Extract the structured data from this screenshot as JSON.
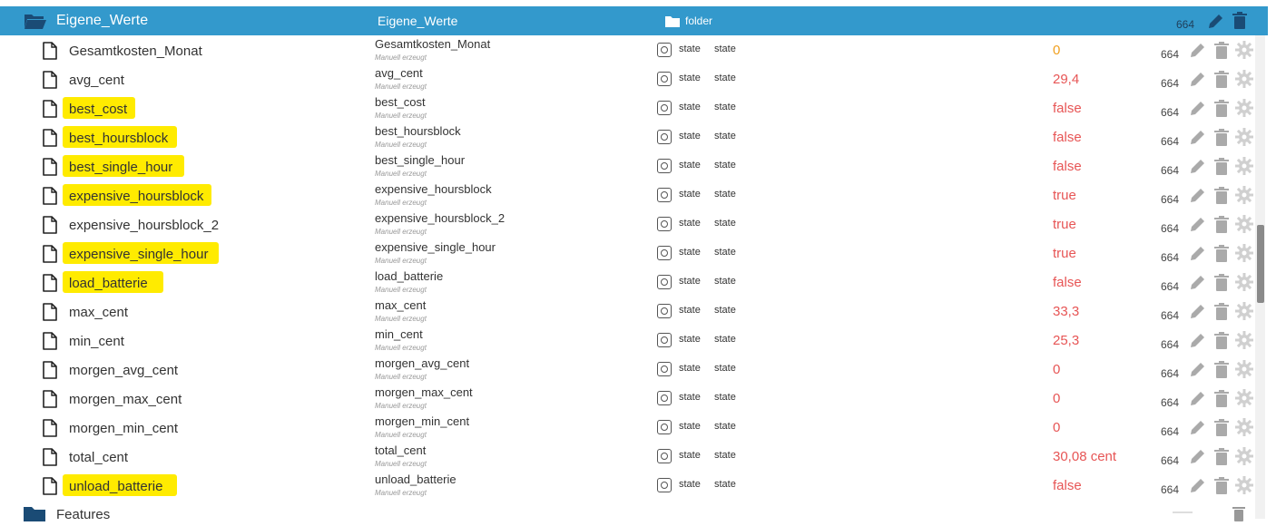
{
  "header": {
    "name": "Eigene_Werte",
    "name2": "Eigene_Werte",
    "type_label": "folder",
    "acl": "664",
    "icon": "folder-open-icon",
    "color": "#3399cc"
  },
  "rows": [
    {
      "name": "Gesamtkosten_Monat",
      "sub": "Manuell erzeugt",
      "role": "state",
      "type": "state",
      "value": "0",
      "value_color": "#f0a020",
      "acl": "664",
      "highlighted": false
    },
    {
      "name": "avg_cent",
      "sub": "Manuell erzeugt",
      "role": "state",
      "type": "state",
      "value": "29,4",
      "value_color": "#e75555",
      "acl": "664",
      "highlighted": false
    },
    {
      "name": "best_cost",
      "sub": "Manuell erzeugt",
      "role": "state",
      "type": "state",
      "value": "false",
      "value_color": "#e75555",
      "acl": "664",
      "highlighted": true
    },
    {
      "name": "best_hoursblock",
      "sub": "Manuell erzeugt",
      "role": "state",
      "type": "state",
      "value": "false",
      "value_color": "#e75555",
      "acl": "664",
      "highlighted": true
    },
    {
      "name": "best_single_hour",
      "sub": "Manuell erzeugt",
      "role": "state",
      "type": "state",
      "value": "false",
      "value_color": "#e75555",
      "acl": "664",
      "highlighted": true
    },
    {
      "name": "expensive_hoursblock",
      "sub": "Manuell erzeugt",
      "role": "state",
      "type": "state",
      "value": "true",
      "value_color": "#e75555",
      "acl": "664",
      "highlighted": true
    },
    {
      "name": "expensive_hoursblock_2",
      "sub": "Manuell erzeugt",
      "role": "state",
      "type": "state",
      "value": "true",
      "value_color": "#e75555",
      "acl": "664",
      "highlighted": false
    },
    {
      "name": "expensive_single_hour",
      "sub": "Manuell erzeugt",
      "role": "state",
      "type": "state",
      "value": "true",
      "value_color": "#e75555",
      "acl": "664",
      "highlighted": true
    },
    {
      "name": "load_batterie",
      "sub": "Manuell erzeugt",
      "role": "state",
      "type": "state",
      "value": "false",
      "value_color": "#e75555",
      "acl": "664",
      "highlighted": true
    },
    {
      "name": "max_cent",
      "sub": "Manuell erzeugt",
      "role": "state",
      "type": "state",
      "value": "33,3",
      "value_color": "#e75555",
      "acl": "664",
      "highlighted": false
    },
    {
      "name": "min_cent",
      "sub": "Manuell erzeugt",
      "role": "state",
      "type": "state",
      "value": "25,3",
      "value_color": "#e75555",
      "acl": "664",
      "highlighted": false
    },
    {
      "name": "morgen_avg_cent",
      "sub": "Manuell erzeugt",
      "role": "state",
      "type": "state",
      "value": "0",
      "value_color": "#e75555",
      "acl": "664",
      "highlighted": false
    },
    {
      "name": "morgen_max_cent",
      "sub": "Manuell erzeugt",
      "role": "state",
      "type": "state",
      "value": "0",
      "value_color": "#e75555",
      "acl": "664",
      "highlighted": false
    },
    {
      "name": "morgen_min_cent",
      "sub": "Manuell erzeugt",
      "role": "state",
      "type": "state",
      "value": "0",
      "value_color": "#e75555",
      "acl": "664",
      "highlighted": false
    },
    {
      "name": "total_cent",
      "sub": "Manuell erzeugt",
      "role": "state",
      "type": "state",
      "value": "30,08 cent",
      "value_color": "#e75555",
      "acl": "664",
      "highlighted": false
    },
    {
      "name": "unload_batterie",
      "sub": "Manuell erzeugt",
      "role": "state",
      "type": "state",
      "value": "false",
      "value_color": "#e75555",
      "acl": "664",
      "highlighted": true
    }
  ],
  "features": {
    "name": "Features",
    "icon": "folder-icon"
  },
  "highlight_color": "#ffeb00"
}
